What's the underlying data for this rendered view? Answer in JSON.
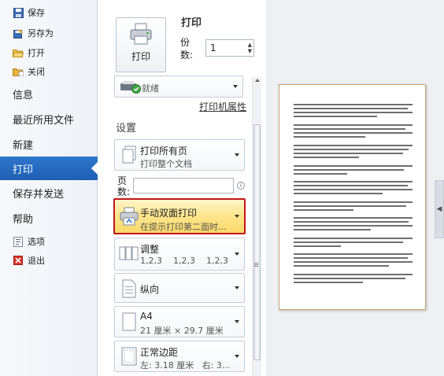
{
  "nav": {
    "save": "保存",
    "save_as": "另存为",
    "open": "打开",
    "close": "关闭",
    "info": "信息",
    "recent": "最近所用文件",
    "new": "新建",
    "print": "打印",
    "save_send": "保存并发送",
    "help": "帮助",
    "options": "选项",
    "exit": "退出"
  },
  "print_section": {
    "title": "打印",
    "print_button": "打印",
    "copies_label": "份数:",
    "copies_value": "1"
  },
  "printer": {
    "status": "就绪",
    "properties_link": "打印机属性"
  },
  "settings": {
    "title": "设置",
    "print_range": {
      "title": "打印所有页",
      "subtitle": "打印整个文档"
    },
    "pages_label": "页数:",
    "pages_value": "",
    "duplex": {
      "title": "手动双面打印",
      "subtitle": "在提示打印第二面时..."
    },
    "collate": {
      "title": "调整",
      "subtitle": "1,2,3    1,2,3    1,2,3"
    },
    "orientation": {
      "title": "纵向"
    },
    "paper": {
      "title": "A4",
      "subtitle": "21 厘米 × 29.7 厘米"
    },
    "margins": {
      "title": "正常边距",
      "subtitle": "左: 3.18 厘米   右: 3..."
    }
  },
  "colors": {
    "accent": "#1e5fb3",
    "highlight_border": "#c0161a",
    "highlight_fill": "#fde58b"
  }
}
